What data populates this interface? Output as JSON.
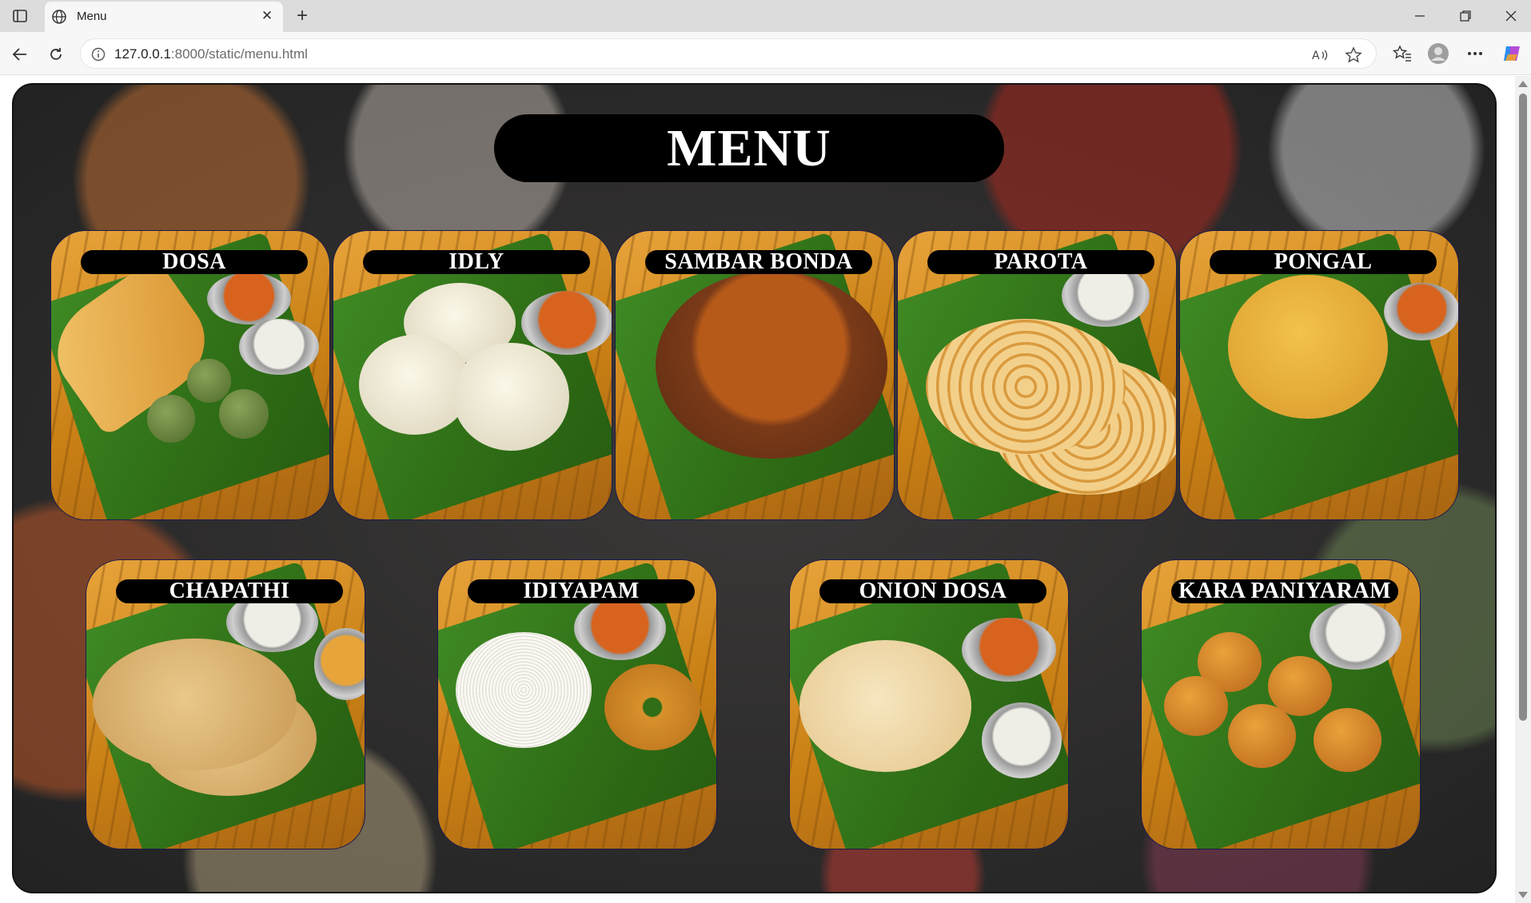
{
  "browser": {
    "tab_title": "Menu",
    "url_host": "127.0.0.1",
    "url_path": ":8000/static/menu.html"
  },
  "page": {
    "title": "MENU",
    "items_row1": [
      {
        "label": "DOSA",
        "icon": "dosa-image"
      },
      {
        "label": "IDLY",
        "icon": "idly-image"
      },
      {
        "label": "SAMBAR BONDA",
        "icon": "sambar-bonda-image"
      },
      {
        "label": "PAROTA",
        "icon": "parota-image"
      },
      {
        "label": "PONGAL",
        "icon": "pongal-image"
      }
    ],
    "items_row2": [
      {
        "label": "CHAPATHI",
        "icon": "chapathi-image"
      },
      {
        "label": "IDIYAPAM",
        "icon": "idiyapam-image"
      },
      {
        "label": "ONION DOSA",
        "icon": "onion-dosa-image"
      },
      {
        "label": "KARA PANIYARAM",
        "icon": "kara-paniyaram-image"
      }
    ]
  },
  "colors": {
    "title_bg": "#000000",
    "label_bg": "#000000",
    "label_text": "#ffffff",
    "leaf_green": "#2f6e16",
    "wood": "#c98015"
  }
}
